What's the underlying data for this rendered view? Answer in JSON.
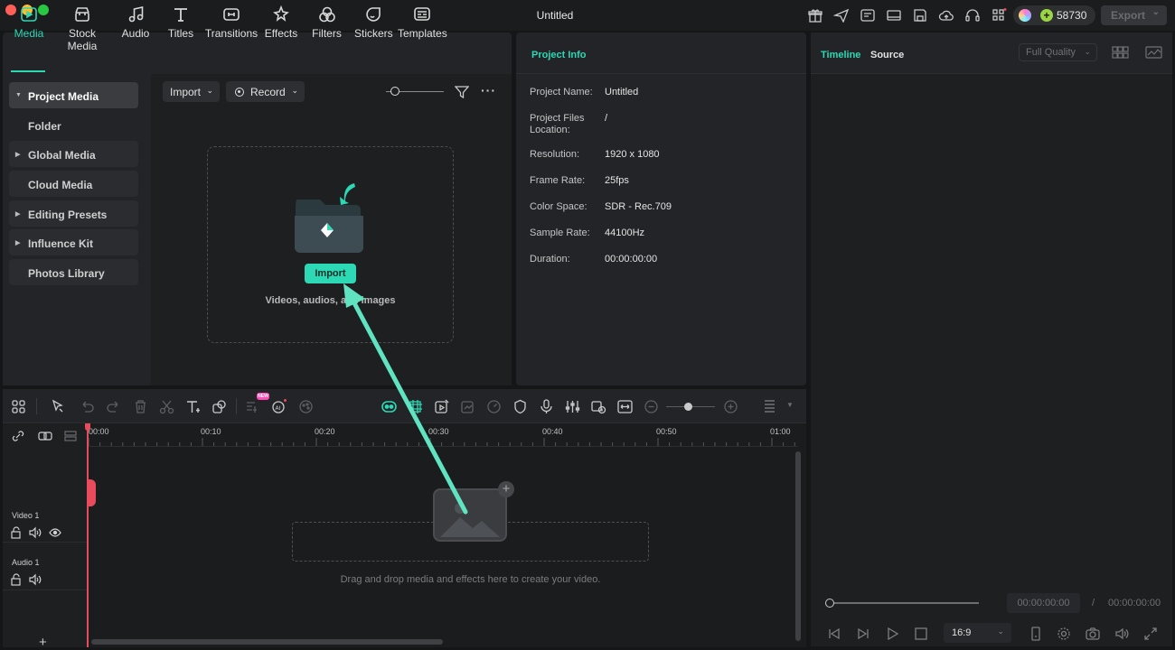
{
  "window": {
    "title": "Untitled"
  },
  "titlebar": {
    "credits": "58730",
    "export_label": "Export",
    "export_dropdown": "⌄",
    "icons": [
      "gift-icon",
      "send-icon",
      "media-cache-icon",
      "layout-icon",
      "save-icon",
      "cloud-upload-icon",
      "headset-icon",
      "apps-grid-icon"
    ]
  },
  "tabs": [
    {
      "label": "Media",
      "active": true
    },
    {
      "label": "Stock Media"
    },
    {
      "label": "Audio"
    },
    {
      "label": "Titles"
    },
    {
      "label": "Transitions"
    },
    {
      "label": "Effects"
    },
    {
      "label": "Filters"
    },
    {
      "label": "Stickers"
    },
    {
      "label": "Templates"
    }
  ],
  "sidebar": {
    "items": [
      {
        "label": "Project Media",
        "expandable": true,
        "selected": true
      },
      {
        "label": "Folder"
      },
      {
        "label": "Global Media",
        "expandable": true
      },
      {
        "label": "Cloud Media"
      },
      {
        "label": "Editing Presets",
        "expandable": true
      },
      {
        "label": "Influence Kit",
        "expandable": true
      },
      {
        "label": "Photos Library"
      }
    ]
  },
  "media_toolbar": {
    "import_label": "Import",
    "record_label": "Record"
  },
  "dropzone": {
    "button_label": "Import",
    "hint": "Videos, audios, and images"
  },
  "project_info": {
    "title": "Project Info",
    "rows": [
      {
        "label": "Project Name:",
        "value": "Untitled"
      },
      {
        "label": "Project Files Location:",
        "value": "/"
      },
      {
        "label": "Resolution:",
        "value": "1920 x 1080"
      },
      {
        "label": "Frame Rate:",
        "value": "25fps"
      },
      {
        "label": "Color Space:",
        "value": "SDR - Rec.709"
      },
      {
        "label": "Sample Rate:",
        "value": "44100Hz"
      },
      {
        "label": "Duration:",
        "value": "00:00:00:00"
      }
    ]
  },
  "player": {
    "tab_timeline": "Timeline",
    "tab_source": "Source",
    "quality": "Full Quality",
    "current_time": "00:00:00:00",
    "separator": "/",
    "total_time": "00:00:00:00",
    "aspect_ratio": "16:9"
  },
  "timeline": {
    "ruler_labels": [
      "00:00",
      "00:10",
      "00:20",
      "00:30",
      "00:40",
      "00:50",
      "01:00"
    ],
    "tracks": [
      {
        "name": "Video 1"
      },
      {
        "name": "Audio 1"
      }
    ],
    "drop_hint": "Drag and drop media and effects here to create your video.",
    "new_badge": "NEW",
    "add_track": "+"
  },
  "colors": {
    "accent": "#2dd8b4",
    "playhead": "#e84b5b",
    "annotation_arrow": "#5fe3c0"
  }
}
